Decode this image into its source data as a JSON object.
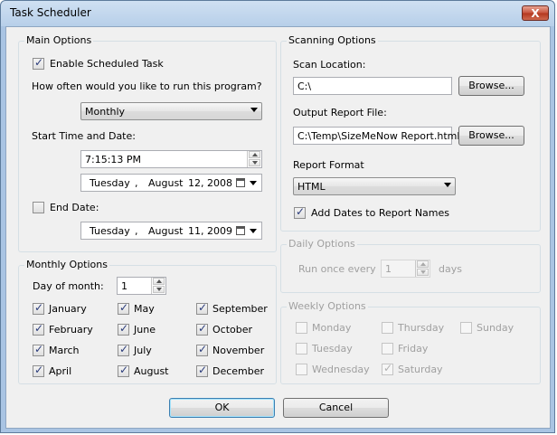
{
  "window": {
    "title": "Task Scheduler",
    "close_glyph": "X"
  },
  "main_options": {
    "title": "Main Options",
    "enable_label": "Enable Scheduled Task",
    "enable_checked": true,
    "frequency_question": "How often would you like to run this program?",
    "frequency_value": "Monthly",
    "start_label": "Start Time and Date:",
    "start_time": "7:15:13 PM",
    "start_date": {
      "weekday": "Tuesday",
      "comma": ",",
      "month": "August",
      "day": "12, 2008"
    },
    "end_label": "End Date:",
    "end_checked": false,
    "end_date": {
      "weekday": "Tuesday",
      "comma": ",",
      "month": "August",
      "day": "11, 2009"
    }
  },
  "scanning_options": {
    "title": "Scanning Options",
    "scan_location_label": "Scan Location:",
    "scan_location_value": "C:\\",
    "browse_label": "Browse...",
    "output_label": "Output Report File:",
    "output_value": "C:\\Temp\\SizeMeNow Report.html",
    "format_label": "Report Format",
    "format_value": "HTML",
    "add_dates_label": "Add Dates to Report Names",
    "add_dates_checked": true
  },
  "daily_options": {
    "title": "Daily Options",
    "run_once_label": "Run once every",
    "days_value": "1",
    "days_label": "days"
  },
  "monthly_options": {
    "title": "Monthly Options",
    "day_label": "Day of month:",
    "day_value": "1",
    "months": [
      {
        "label": "January",
        "checked": true
      },
      {
        "label": "February",
        "checked": true
      },
      {
        "label": "March",
        "checked": true
      },
      {
        "label": "April",
        "checked": true
      },
      {
        "label": "May",
        "checked": true
      },
      {
        "label": "June",
        "checked": true
      },
      {
        "label": "July",
        "checked": true
      },
      {
        "label": "August",
        "checked": true
      },
      {
        "label": "September",
        "checked": true
      },
      {
        "label": "October",
        "checked": true
      },
      {
        "label": "November",
        "checked": true
      },
      {
        "label": "December",
        "checked": true
      }
    ]
  },
  "weekly_options": {
    "title": "Weekly Options",
    "days": [
      {
        "label": "Monday",
        "checked": false
      },
      {
        "label": "Tuesday",
        "checked": false
      },
      {
        "label": "Wednesday",
        "checked": false
      },
      {
        "label": "Thursday",
        "checked": false
      },
      {
        "label": "Friday",
        "checked": false
      },
      {
        "label": "Saturday",
        "checked": true
      },
      {
        "label": "Sunday",
        "checked": false
      }
    ]
  },
  "buttons": {
    "ok": "OK",
    "cancel": "Cancel"
  },
  "icons": {
    "check": "✓"
  }
}
